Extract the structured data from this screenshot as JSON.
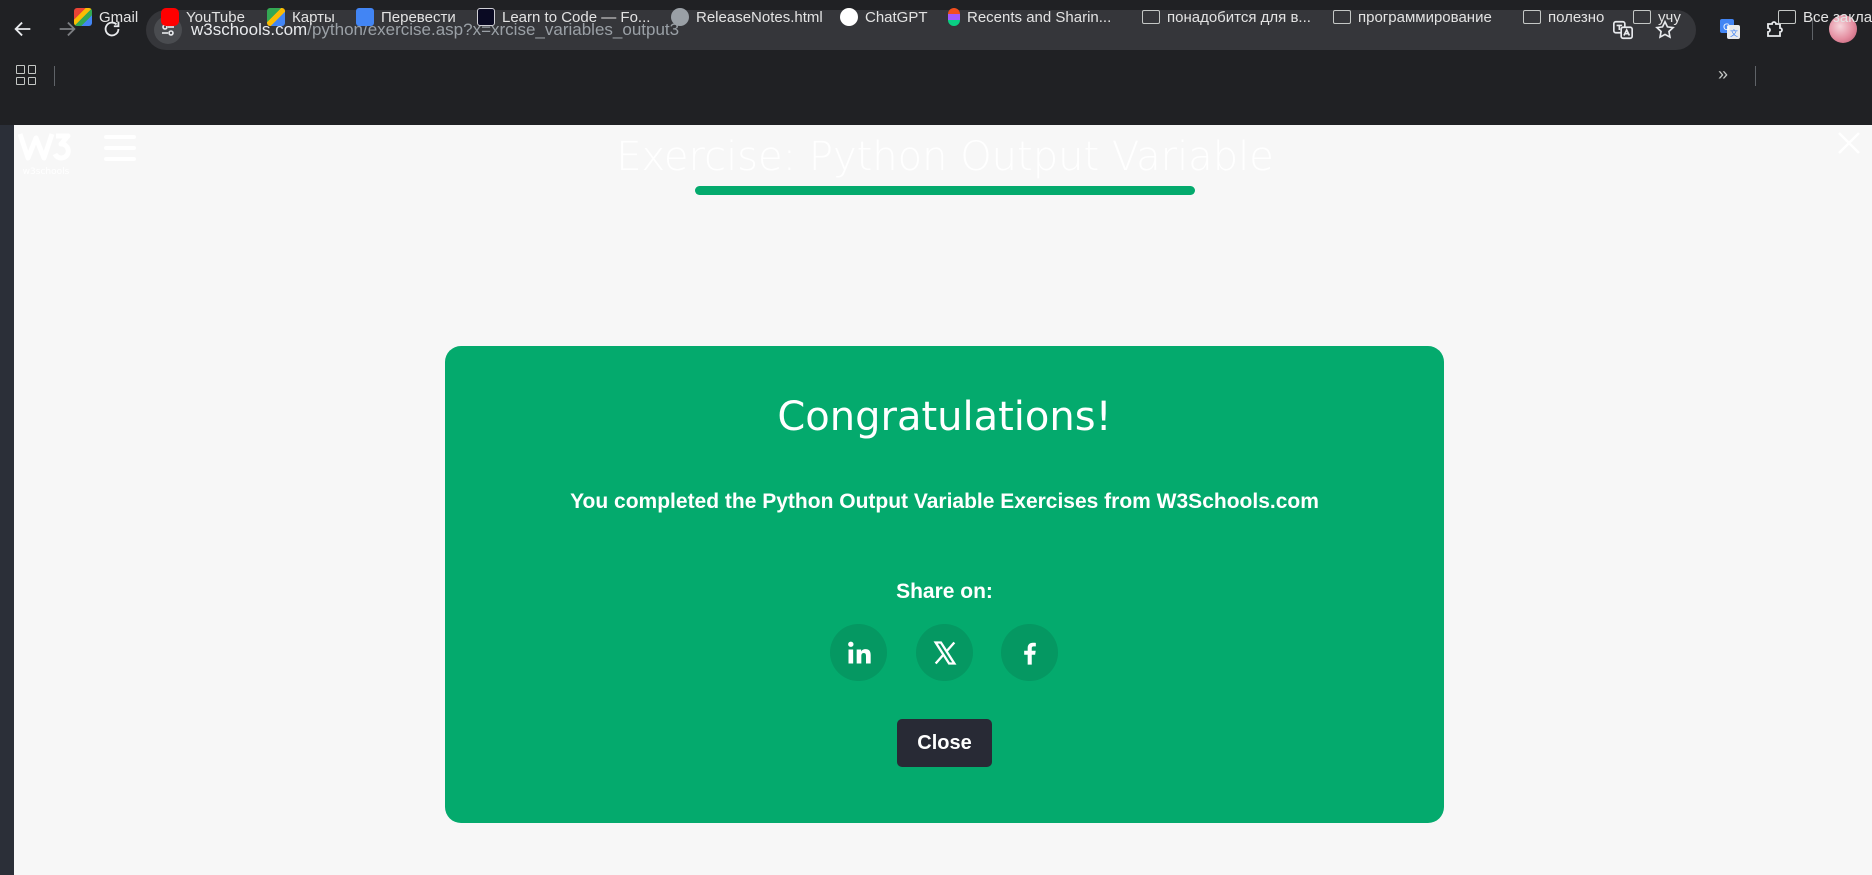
{
  "browser": {
    "url": {
      "host": "w3schools.com",
      "path": "/python/exercise.asp?x=xrcise_variables_output3"
    },
    "bookmarks": [
      {
        "label": "Gmail",
        "icon": "gmail-icon"
      },
      {
        "label": "YouTube",
        "icon": "youtube-icon"
      },
      {
        "label": "Карты",
        "icon": "maps-icon"
      },
      {
        "label": "Перевести",
        "icon": "translate-icon"
      },
      {
        "label": "Learn to Code — Fo...",
        "icon": "freecodecamp-icon"
      },
      {
        "label": "ReleaseNotes.html",
        "icon": "globe-icon"
      },
      {
        "label": "ChatGPT",
        "icon": "chatgpt-icon"
      },
      {
        "label": "Recents and Sharin...",
        "icon": "figma-icon"
      },
      {
        "label": "понадобится для в...",
        "icon": "folder-icon"
      },
      {
        "label": "программирование",
        "icon": "folder-icon"
      },
      {
        "label": "полезно",
        "icon": "folder-icon"
      },
      {
        "label": "учу",
        "icon": "folder-icon"
      }
    ],
    "other_bookmarks": "Все закла"
  },
  "header": {
    "logo_text": "w3schools",
    "title": "Exercise: Python Output Variable",
    "progress_fraction": 1.0
  },
  "modal": {
    "title": "Congratulations!",
    "message": "You completed the Python Output Variable Exercises from W3Schools.com",
    "share_label": "Share on:",
    "share_targets": [
      "linkedin-icon",
      "x-icon",
      "facebook-icon"
    ],
    "close_label": "Close"
  },
  "colors": {
    "accent": "#04aa6d",
    "close_button": "#282a35",
    "page_bg": "#f7f7f7"
  }
}
